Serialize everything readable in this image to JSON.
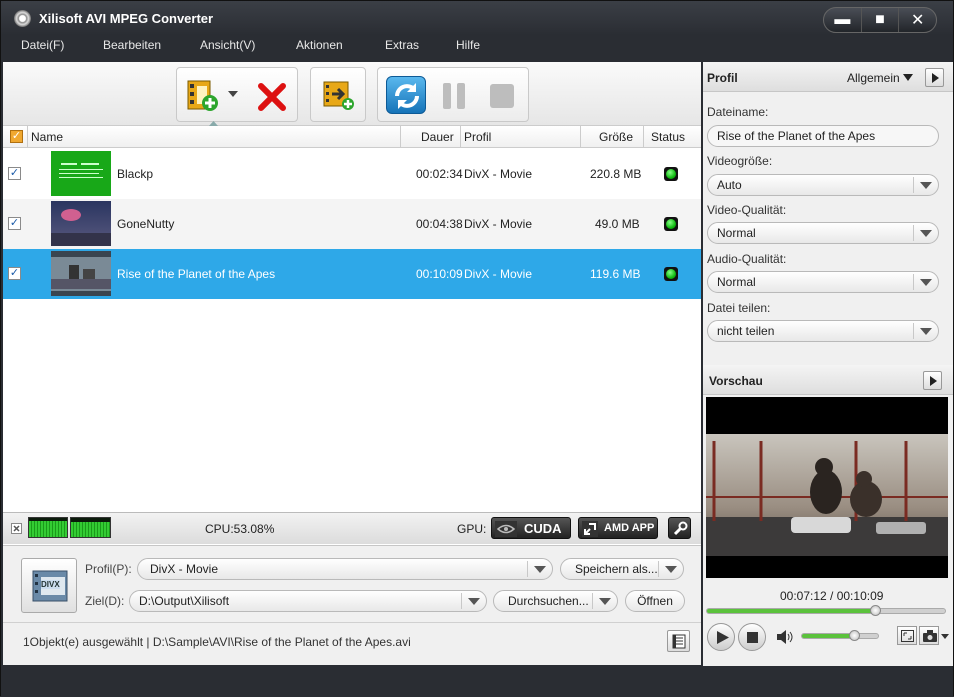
{
  "window": {
    "title": "Xilisoft AVI MPEG Converter",
    "min": "▬",
    "max": "■",
    "close": "✕"
  },
  "menu": [
    "Datei(F)",
    "Bearbeiten",
    "Ansicht(V)",
    "Aktionen",
    "Extras",
    "Hilfe"
  ],
  "columns": {
    "name": "Name",
    "dauer": "Dauer",
    "profil": "Profil",
    "groesse": "Größe",
    "status": "Status"
  },
  "files": [
    {
      "name": "Blackp",
      "duration": "00:02:34",
      "profile": "DivX - Movie",
      "size": "220.8 MB",
      "checked": "✓"
    },
    {
      "name": "GoneNutty",
      "duration": "00:04:38",
      "profile": "DivX - Movie",
      "size": "49.0 MB",
      "checked": "✓"
    },
    {
      "name": "Rise of the Planet of the Apes",
      "duration": "00:10:09",
      "profile": "DivX - Movie",
      "size": "119.6 MB",
      "checked": "✓"
    }
  ],
  "cpu": {
    "label": "CPU:53.08%"
  },
  "gpu": {
    "label": "GPU:",
    "cuda": "CUDA",
    "amd": "AMD APP"
  },
  "output": {
    "profile_label": "Profil(P):",
    "profile_value": "DivX - Movie",
    "save_as": "Speichern als...",
    "dest_label": "Ziel(D):",
    "dest_value": "D:\\Output\\Xilisoft",
    "browse": "Durchsuchen...",
    "open": "Öffnen",
    "divx_badge": "DIVX"
  },
  "status_text": "1Objekt(e) ausgewählt | D:\\Sample\\AVI\\Rise of the Planet of the Apes.avi",
  "profile_panel": {
    "title": "Profil",
    "mode": "Allgemein",
    "filename_label": "Dateiname:",
    "filename": "Rise of the Planet of the Apes",
    "size_label": "Videogröße:",
    "size": "Auto",
    "vq_label": "Video-Qualität:",
    "vq": "Normal",
    "aq_label": "Audio-Qualität:",
    "aq": "Normal",
    "split_label": "Datei teilen:",
    "split": "nicht teilen"
  },
  "preview": {
    "title": "Vorschau",
    "time": "00:07:12 / 00:10:09",
    "progress": 0.71,
    "volume": 0.7
  },
  "colors": {
    "accent": "#2ea8e8",
    "selected_row": "#2ea8e8",
    "chrome": "#2a2d33"
  }
}
